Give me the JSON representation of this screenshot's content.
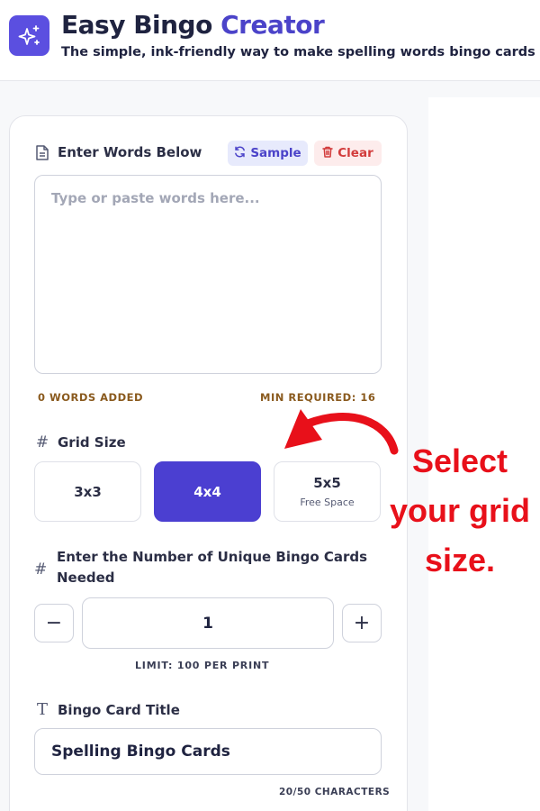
{
  "header": {
    "title_main": "Easy Bingo",
    "title_accent": "Creator",
    "subtitle": "The simple, ink-friendly way to make spelling words bingo cards"
  },
  "words": {
    "label": "Enter Words Below",
    "sample_label": "Sample",
    "clear_label": "Clear",
    "placeholder": "Type or paste words here...",
    "value": "",
    "words_added": "0 WORDS ADDED",
    "min_required": "MIN REQUIRED: 16"
  },
  "grid": {
    "label": "Grid Size",
    "options": [
      {
        "label": "3x3",
        "sub": ""
      },
      {
        "label": "4x4",
        "sub": ""
      },
      {
        "label": "5x5",
        "sub": "Free Space"
      }
    ],
    "selected": "4x4"
  },
  "cards": {
    "label": "Enter the Number of Unique Bingo Cards Needed",
    "value": "1",
    "decrement": "−",
    "increment": "+",
    "limit": "LIMIT: 100 PER PRINT"
  },
  "title_field": {
    "label": "Bingo Card Title",
    "value": "Spelling Bingo Cards",
    "char_count": "20/50 CHARACTERS"
  },
  "annotation": {
    "lines": [
      "Select",
      "your grid",
      "size."
    ],
    "color": "#e8101a"
  },
  "colors": {
    "accent": "#4b43c9",
    "active_button": "#4b3fd1",
    "danger": "#d23b3b"
  },
  "icons": {
    "logo": "sparkles-icon",
    "words": "document-icon",
    "sample": "refresh-icon",
    "clear": "trash-icon",
    "grid": "hash-icon",
    "title": "type-icon"
  }
}
